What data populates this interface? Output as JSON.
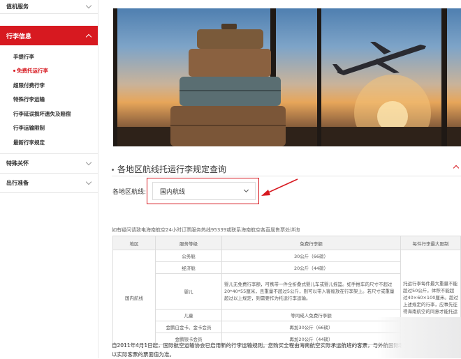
{
  "sidebar": {
    "top_item": "值机服务",
    "active_section": "行李信息",
    "sub_items": [
      "手提行李",
      "免费托运行李",
      "超限付费行李",
      "特殊行李运输",
      "行李延误损坏遗失及赔偿",
      "行李运输限制",
      "最新行李规定"
    ],
    "sections": [
      "特殊关怀",
      "出行准备"
    ]
  },
  "query": {
    "title": "各地区航线托运行李规定查询",
    "route_label": "各地区航线:",
    "route_value": "国内航线",
    "note": "如有疑问请致电海南航空24小时订票服务热线95339或联系海南航空各直属售票处详询"
  },
  "table": {
    "headers": [
      "地区",
      "服务等级",
      "免费行李额",
      "每件行李最大限制"
    ],
    "region": "国内航线",
    "rows": [
      {
        "cls": "公务舱",
        "allow": "30公斤（66磅）"
      },
      {
        "cls": "经济舱",
        "allow": "20公斤（44磅）"
      },
      {
        "cls": "婴儿",
        "allow": "婴儿无免费行李额，可携带一件全折叠式婴儿车或婴儿摇篮。如手推车的尺寸不超过20*40*55厘米，且重量不超过5公斤，则可以带入客舱放在行李架上。若尺寸或重量超过以上规定，则需要作为托运行李运输。"
      },
      {
        "cls": "儿童",
        "allow": "等同成人免费行李额"
      },
      {
        "cls": "金鹏白金卡、金卡会员",
        "allow": "再加30公斤（66磅）"
      },
      {
        "cls": "金鹏银卡会员",
        "allow": "再加20公斤（44磅）"
      }
    ],
    "limit": "托运行李每件最大重量不能超过50公斤，体积不能超过40×60×100厘米。超过上述规定的行李，应事先征得海南航空的同意才能托运"
  },
  "footer_text": "自2011年4月1日起，国际航空运输协会已启用新的行李运输规则。您购买全程由海南航空实际承运航班的客票，与外航国际联运客票的免费行李额请以实际客票的票面值为准。"
}
